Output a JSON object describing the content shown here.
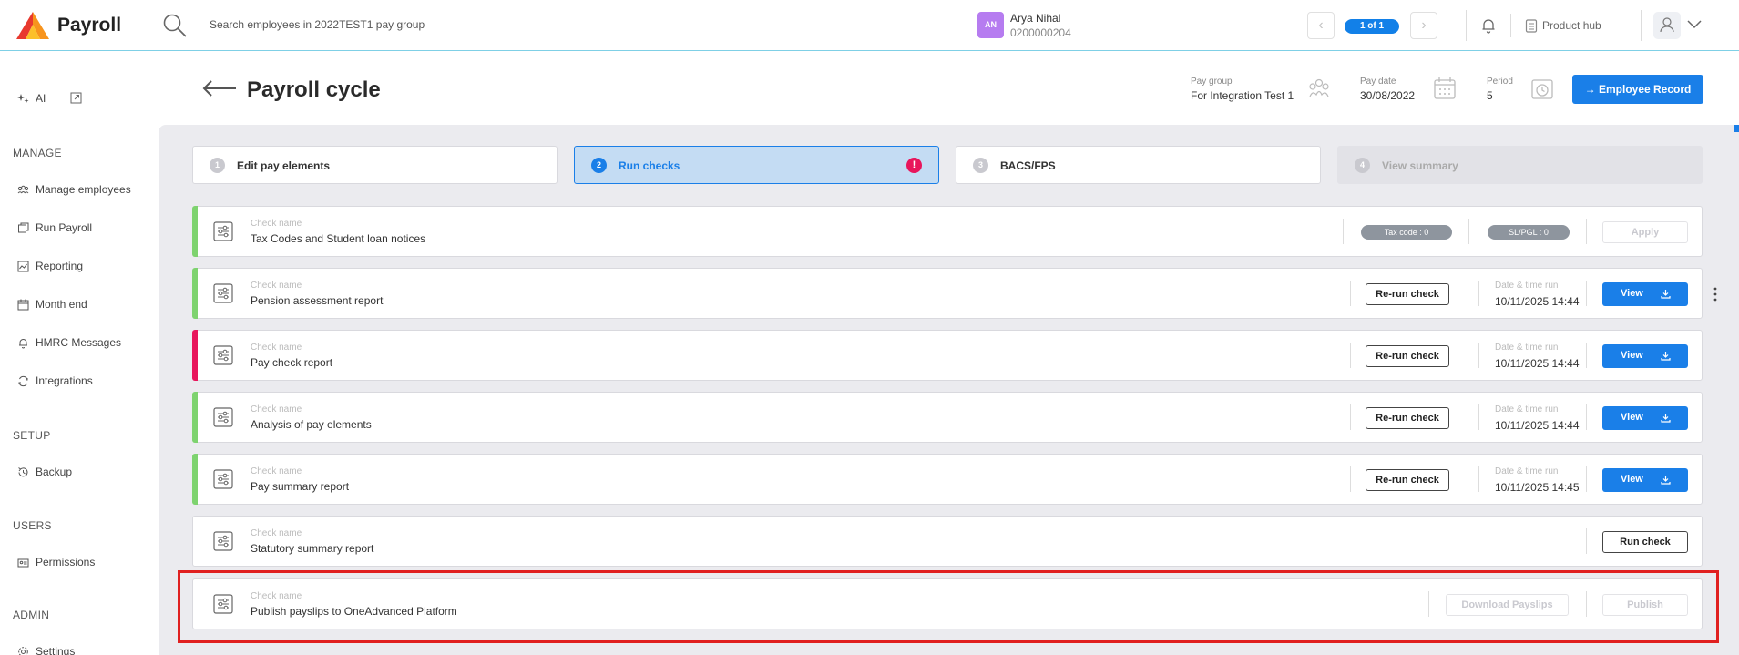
{
  "app": {
    "title": "Payroll"
  },
  "search": {
    "placeholder": "Search employees in 2022TEST1 pay group"
  },
  "employee": {
    "initials": "AN",
    "name": "Arya Nihal",
    "id": "0200000204"
  },
  "pager": {
    "label": "1 of 1"
  },
  "product_hub": {
    "label": "Product hub"
  },
  "sidebar": {
    "ai_label": "AI",
    "sections": [
      {
        "title": "MANAGE",
        "items": [
          "Manage employees",
          "Run Payroll",
          "Reporting",
          "Month end",
          "HMRC Messages",
          "Integrations"
        ]
      },
      {
        "title": "SETUP",
        "items": [
          "Backup"
        ]
      },
      {
        "title": "USERS",
        "items": [
          "Permissions"
        ]
      },
      {
        "title": "ADMIN",
        "items": [
          "Settings"
        ]
      }
    ]
  },
  "header": {
    "title": "Payroll cycle",
    "pay_group_label": "Pay group",
    "pay_group_value": "For Integration Test 1",
    "pay_date_label": "Pay date",
    "pay_date_value": "30/08/2022",
    "period_label": "Period",
    "period_value": "5",
    "employee_record_label": "Employee Record"
  },
  "steps": [
    {
      "num": "1",
      "label": "Edit pay elements"
    },
    {
      "num": "2",
      "label": "Run checks",
      "alert": "!"
    },
    {
      "num": "3",
      "label": "BACS/FPS"
    },
    {
      "num": "4",
      "label": "View summary"
    }
  ],
  "checks": {
    "check_name_label": "Check name",
    "datetime_label": "Date & time run",
    "rows": [
      {
        "name": "Tax Codes and Student loan notices",
        "tax_code_pill": "Tax code : 0",
        "slpgl_pill": "SL/PGL : 0",
        "apply_label": "Apply"
      },
      {
        "name": "Pension assessment report",
        "rerun_label": "Re-run check",
        "datetime": "10/11/2025 14:44",
        "view_label": "View"
      },
      {
        "name": "Pay check report",
        "rerun_label": "Re-run check",
        "datetime": "10/11/2025 14:44",
        "view_label": "View"
      },
      {
        "name": "Analysis of pay elements",
        "rerun_label": "Re-run check",
        "datetime": "10/11/2025 14:44",
        "view_label": "View"
      },
      {
        "name": "Pay summary report",
        "rerun_label": "Re-run check",
        "datetime": "10/11/2025 14:45",
        "view_label": "View"
      },
      {
        "name": "Statutory summary report",
        "run_label": "Run check"
      },
      {
        "name": "Publish payslips to OneAdvanced Platform",
        "download_label": "Download Payslips",
        "publish_label": "Publish"
      }
    ]
  },
  "colors": {
    "accent": "#1a7fe8",
    "success": "#7ed36f",
    "error": "#e8165c",
    "highlight": "#e02020"
  }
}
